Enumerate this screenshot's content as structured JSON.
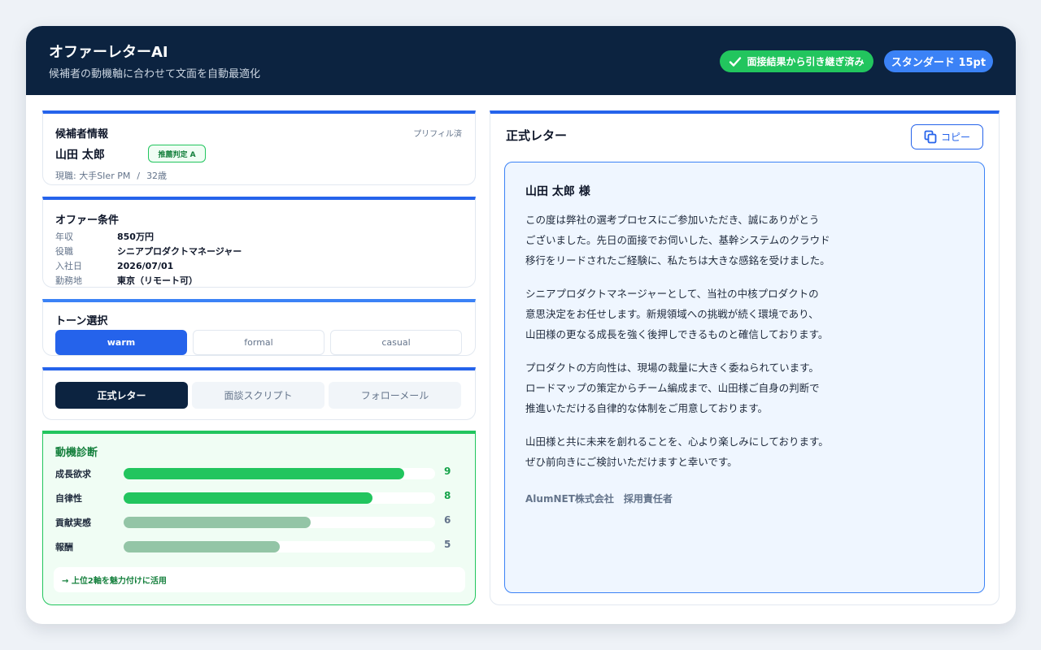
{
  "header": {
    "title": "オファーレターAI",
    "subtitle": "候補者の動機軸に合わせて文面を自動最適化",
    "interview_badge": "面接結果から引き継ぎ済み",
    "plan_badge": "スタンダード 15pt"
  },
  "candidate": {
    "title": "候補者情報",
    "prefill": "プリフィル済",
    "name": "山田 太郎",
    "recommendation": "推薦判定 A",
    "current_job": "現職: 大手SIer PM",
    "age": "32歳"
  },
  "offer": {
    "title": "オファー条件",
    "rows": [
      {
        "label": "年収",
        "value": "850万円"
      },
      {
        "label": "役職",
        "value": "シニアプロダクトマネージャー"
      },
      {
        "label": "入社日",
        "value": "2026/07/01"
      },
      {
        "label": "勤務地",
        "value": "東京（リモート可）"
      }
    ]
  },
  "tone": {
    "title": "トーン選択",
    "options": [
      "warm",
      "formal",
      "casual"
    ],
    "selected": "warm"
  },
  "doc_tabs": {
    "tabs": [
      "正式レター",
      "面談スクリプト",
      "フォローメール"
    ],
    "selected": "正式レター"
  },
  "motivation": {
    "title": "動機診断",
    "max": 10,
    "items": [
      {
        "label": "成長欲求",
        "score": 9,
        "color": "#22c55e",
        "value_color": "#16a34a"
      },
      {
        "label": "自律性",
        "score": 8,
        "color": "#22c55e",
        "value_color": "#16a34a"
      },
      {
        "label": "貢献実感",
        "score": 6,
        "color": "#93c5a6",
        "value_color": "#64748b"
      },
      {
        "label": "報酬",
        "score": 5,
        "color": "#93c5a6",
        "value_color": "#64748b"
      }
    ],
    "hint": "→ 上位2軸を魅力付けに活用"
  },
  "letter": {
    "title": "正式レター",
    "copy_label": "コピー",
    "greeting": "山田 太郎 様",
    "paragraphs": [
      [
        "この度は弊社の選考プロセスにご参加いただき、誠にありがとう",
        "ございました。先日の面接でお伺いした、基幹システムのクラウド",
        "移行をリードされたご経験に、私たちは大きな感銘を受けました。"
      ],
      [
        "シニアプロダクトマネージャーとして、当社の中核プロダクトの",
        "意思決定をお任せします。新規領域への挑戦が続く環境であり、",
        "山田様の更なる成長を強く後押しできるものと確信しております。"
      ],
      [
        "プロダクトの方向性は、現場の裁量に大きく委ねられています。",
        "ロードマップの策定からチーム編成まで、山田様ご自身の判断で",
        "推進いただける自律的な体制をご用意しております。"
      ],
      [
        "山田様と共に未来を創れることを、心より楽しみにしております。",
        "ぜひ前向きにご検討いただけますと幸いです。"
      ]
    ],
    "signature": "AlumNET株式会社　採用責任者"
  },
  "colors": {
    "header_bg": "#0c2340",
    "accent": "#2563eb",
    "success": "#22c55e"
  }
}
